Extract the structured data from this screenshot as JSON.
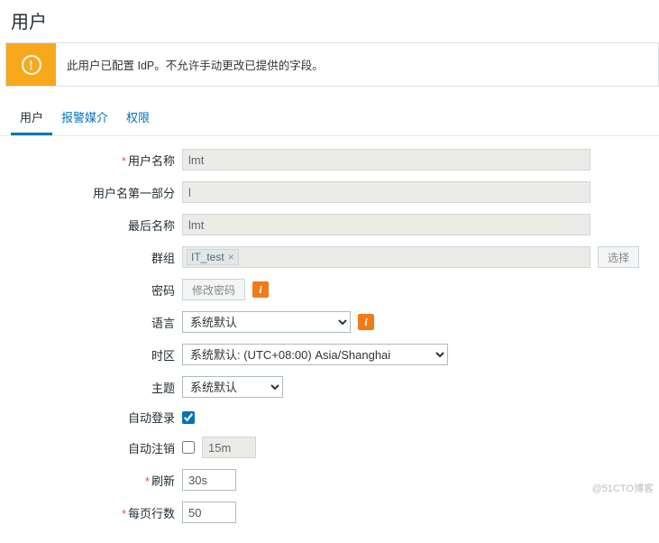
{
  "page": {
    "title": "用户"
  },
  "warning": {
    "text": "此用户已配置 IdP。不允许手动更改已提供的字段。"
  },
  "tabs": {
    "user": "用户",
    "media": "报警媒介",
    "perm": "权限"
  },
  "labels": {
    "username": "用户名称",
    "username_first": "用户名第一部分",
    "lastname": "最后名称",
    "groups": "群组",
    "password": "密码",
    "language": "语言",
    "timezone": "时区",
    "theme": "主题",
    "autologin": "自动登录",
    "autologout": "自动注销",
    "refresh": "刷新",
    "rows": "每页行数"
  },
  "values": {
    "username": "lmt",
    "username_first": "l",
    "lastname": "lmt",
    "group_tag": "IT_test",
    "select_btn": "选择",
    "change_pw": "修改密码",
    "language": "系统默认",
    "timezone": "系统默认: (UTC+08:00) Asia/Shanghai",
    "theme": "系统默认",
    "autologin_checked": true,
    "autologout_checked": false,
    "autologout_val": "15m",
    "refresh": "30s",
    "rows": "50"
  },
  "watermark": "@51CTO博客"
}
